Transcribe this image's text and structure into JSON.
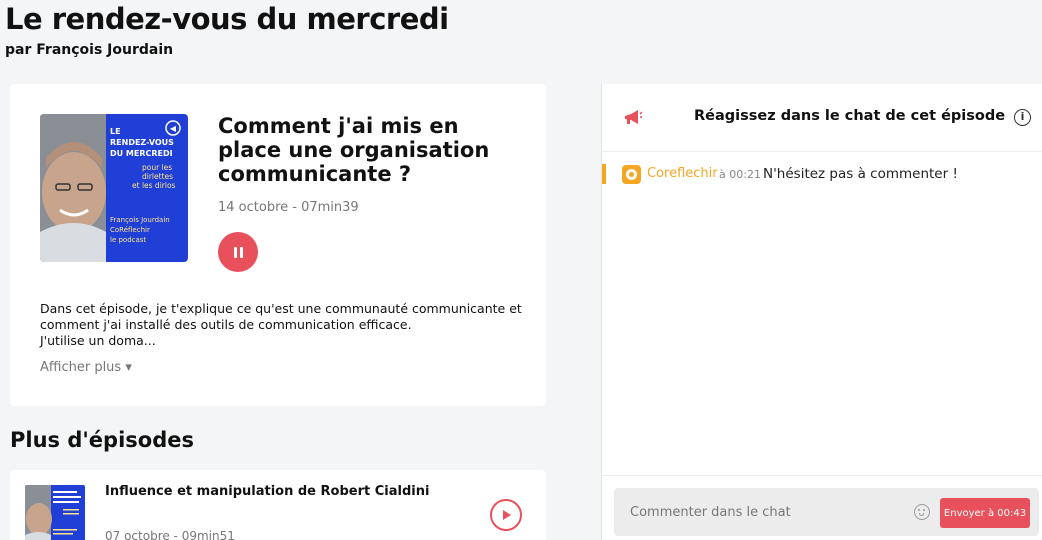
{
  "show": {
    "title": "Le rendez-vous du mercredi",
    "author": "par François Jourdain"
  },
  "current_episode": {
    "cover": {
      "line1": "LE",
      "line2": "RENDEZ-VOUS",
      "line3": "DU MERCREDI",
      "line4": "pour les",
      "line5": "dirlettes",
      "line6": "et les dirlos",
      "line7": "François Jourdain",
      "line8": "CoRéflechir",
      "line9": "le podcast"
    },
    "title": "Comment j'ai mis en place une organisation communicante ?",
    "meta": "14 octobre - 07min39",
    "description_lines": [
      "Dans cet épisode, je t'explique ce qu'est une communauté communicante et",
      "comment j'ai installé des outils de communication efficace.",
      "J'utilise un doma..."
    ],
    "show_more_label": "Afficher plus ▾"
  },
  "more_episodes": {
    "heading": "Plus d'épisodes",
    "items": [
      {
        "title": "Influence et manipulation de Robert Cialdini",
        "meta": "07 octobre - 09min51"
      }
    ]
  },
  "chat": {
    "title": "Réagissez dans le chat de cet épisode",
    "info_label": "i",
    "messages": [
      {
        "user": "Coreflechir",
        "time": "à 00:21",
        "text": "N'hésitez pas à commenter !"
      }
    ],
    "input_placeholder": "Commenter dans le chat",
    "send_label": "Envoyer à 00:43"
  },
  "colors": {
    "accent_red": "#e8505b",
    "chat_orange": "#f5a623",
    "cover_blue": "#1f3fd6"
  }
}
